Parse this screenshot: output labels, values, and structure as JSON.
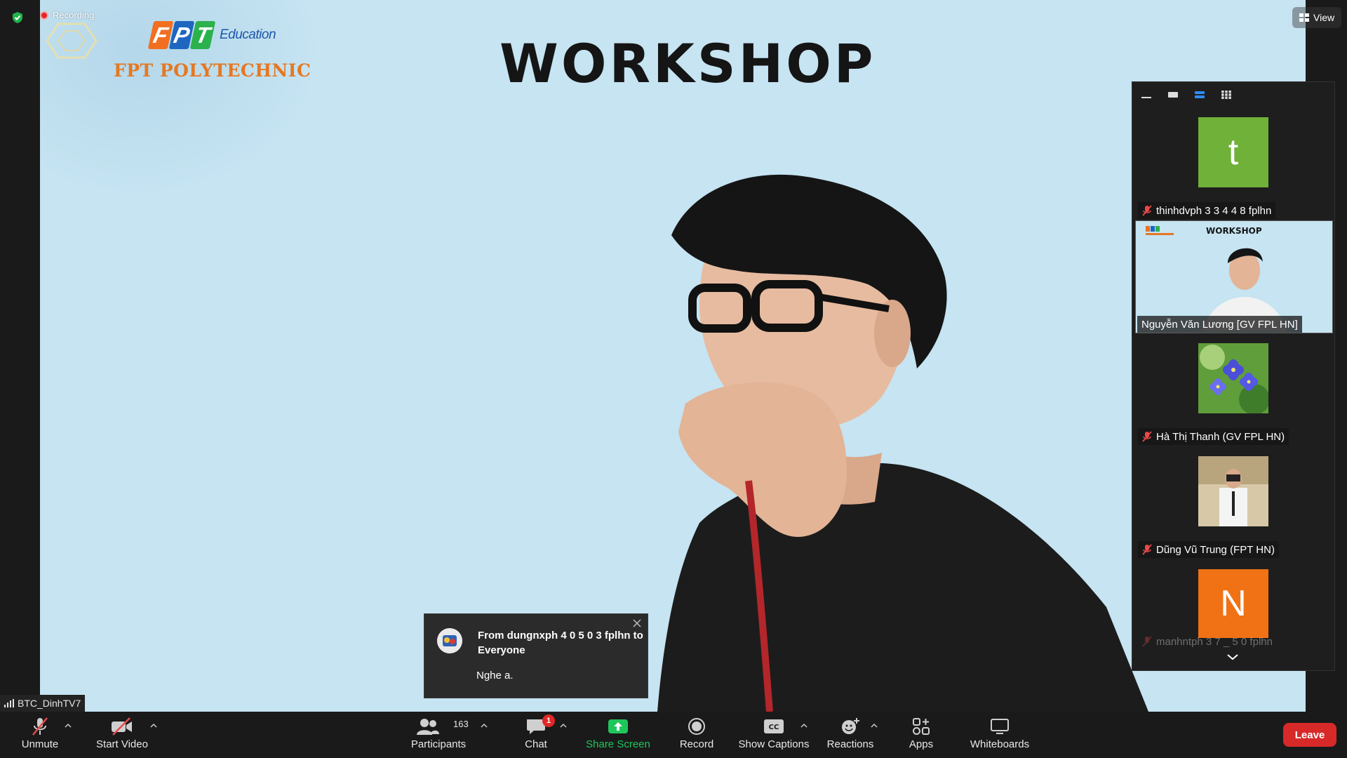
{
  "meeting": {
    "recording_label": "Recording",
    "view_label": "View"
  },
  "slide": {
    "title": "WORKSHOP",
    "brand_education": "Education",
    "brand_poly": "FPT POLYTECHNIC",
    "brand_letters": [
      "F",
      "P",
      "T"
    ],
    "brand_colors": [
      "#f26f21",
      "#1f66c1",
      "#2bb24c"
    ]
  },
  "participants_panel": {
    "tiles": [
      {
        "name": "thinhdvph 3 3 4 4 8 fplhn",
        "avatar_text": "t",
        "avatar_color": "#6fb139",
        "muted": true
      },
      {
        "name": "Nguyễn Văn Lương [GV FPL HN]",
        "mini_title": "WORKSHOP",
        "muted": false
      },
      {
        "name": "Hà Thị Thanh (GV FPL HN)",
        "avatar_kind": "flower-photo",
        "muted": true
      },
      {
        "name": "Dũng Vũ Trung (FPT HN)",
        "avatar_kind": "person-photo",
        "muted": true
      },
      {
        "name": "manhntph 3 7 _ 5 0 fplhn",
        "avatar_text": "N",
        "avatar_color": "#f07214",
        "muted": true
      }
    ]
  },
  "chat_toast": {
    "from_line": "From dungnxph 4 0 5 0 3 fplhn to Everyone",
    "message": "Nghe a."
  },
  "self_view": {
    "name": "BTC_DinhTV7"
  },
  "toolbar": {
    "unmute": "Unmute",
    "start_video": "Start Video",
    "participants": "Participants",
    "participants_count": "163",
    "chat": "Chat",
    "chat_badge": "1",
    "share_screen": "Share Screen",
    "record": "Record",
    "show_captions": "Show Captions",
    "reactions": "Reactions",
    "apps": "Apps",
    "whiteboards": "Whiteboards",
    "leave": "Leave"
  }
}
